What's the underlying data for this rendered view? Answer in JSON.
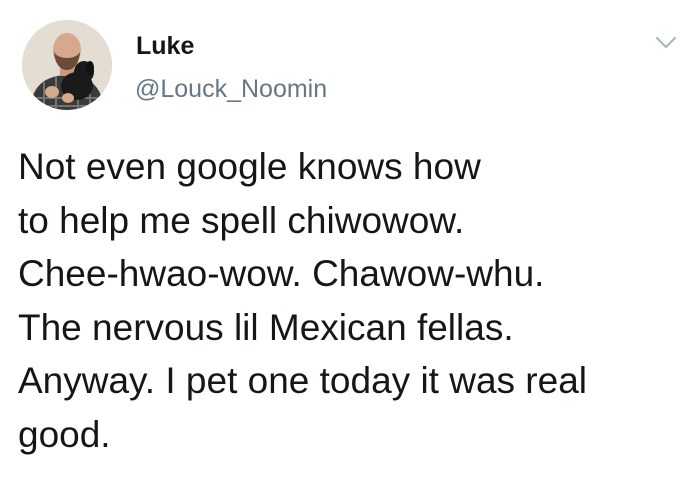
{
  "user": {
    "display_name": "Luke",
    "handle": "@Louck_Noomin",
    "avatar_icon": "profile-photo-with-dog"
  },
  "menu": {
    "icon": "chevron-down-icon"
  },
  "tweet": {
    "lines": [
      "Not even google knows how",
      "to help me spell chiwowow.",
      "Chee-hwao-wow. Chawow-whu.",
      "The nervous lil Mexican fellas.",
      "Anyway. I pet one today it was real",
      "good."
    ]
  },
  "colors": {
    "text": "#14171a",
    "secondary": "#657786",
    "background": "#ffffff"
  }
}
